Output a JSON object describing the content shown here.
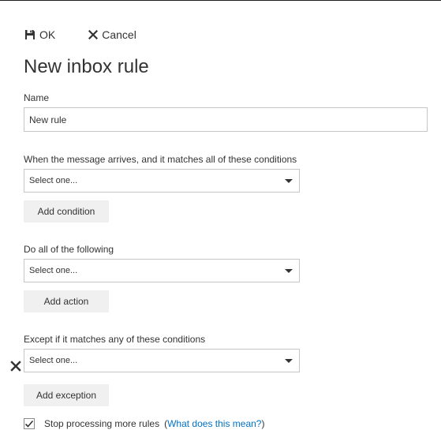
{
  "toolbar": {
    "ok_label": "OK",
    "ok_icon": "save-icon",
    "cancel_label": "Cancel",
    "cancel_icon": "close-icon"
  },
  "page_title": "New inbox rule",
  "name_field": {
    "label": "Name",
    "value": "New rule"
  },
  "conditions": {
    "label": "When the message arrives, and it matches all of these conditions",
    "select_value": "Select one...",
    "add_button": "Add condition"
  },
  "actions": {
    "label": "Do all of the following",
    "select_value": "Select one...",
    "add_button": "Add action"
  },
  "exceptions": {
    "label": "Except if it matches any of these conditions",
    "select_value": "Select one...",
    "add_button": "Add exception",
    "remove_icon": "close-icon"
  },
  "stop_processing": {
    "label": "Stop processing more rules",
    "checked": true,
    "help_open": "(",
    "help_link": "What does this mean?",
    "help_close": ")"
  },
  "colors": {
    "link": "#0072c6",
    "button_bg": "#f0f0f0",
    "border": "#c6c6c6",
    "text": "#333333"
  }
}
